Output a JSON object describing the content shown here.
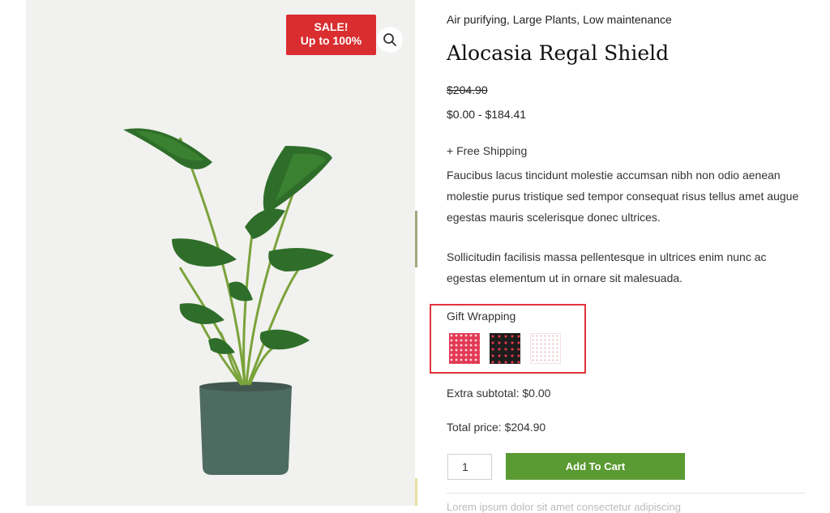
{
  "product": {
    "categories": "Air purifying, Large Plants, Low maintenance",
    "title": "Alocasia Regal Shield",
    "old_price": "$204.90",
    "price_range": "$0.00 - $184.41",
    "shipping": "+ Free Shipping",
    "description_1": "Faucibus lacus tincidunt molestie accumsan nibh non odio aenean molestie purus tristique sed tempor consequat risus tellus amet augue egestas mauris scelerisque donec ultrices.",
    "description_2": "Sollicitudin facilisis massa pellentesque in ultrices enim nunc ac egestas elementum ut in ornare sit malesuada."
  },
  "badge": {
    "line1": "SALE!",
    "line2": "Up to 100%",
    "color": "#d92d30"
  },
  "gallery": {
    "zoom_icon": "search-icon",
    "pot_color": "#4e6b62",
    "leaf_color": "#2f6e2a"
  },
  "gift_wrapping": {
    "label": "Gift Wrapping",
    "options": [
      {
        "name": "red-dots-wrap",
        "color": "#e23a55"
      },
      {
        "name": "black-hearts-wrap",
        "color": "#1d1d1d"
      },
      {
        "name": "white-pink-wrap",
        "color": "#ffffff"
      }
    ],
    "highlight_color": "#e0353a"
  },
  "totals": {
    "extra_subtotal": "Extra subtotal:  $0.00",
    "total_price": "Total price:  $204.90"
  },
  "cart": {
    "quantity": "1",
    "add_label": "Add To Cart",
    "button_color": "#5a9a32"
  },
  "footer_hint": "Lorem ipsum dolor sit amet consectetur adipiscing"
}
